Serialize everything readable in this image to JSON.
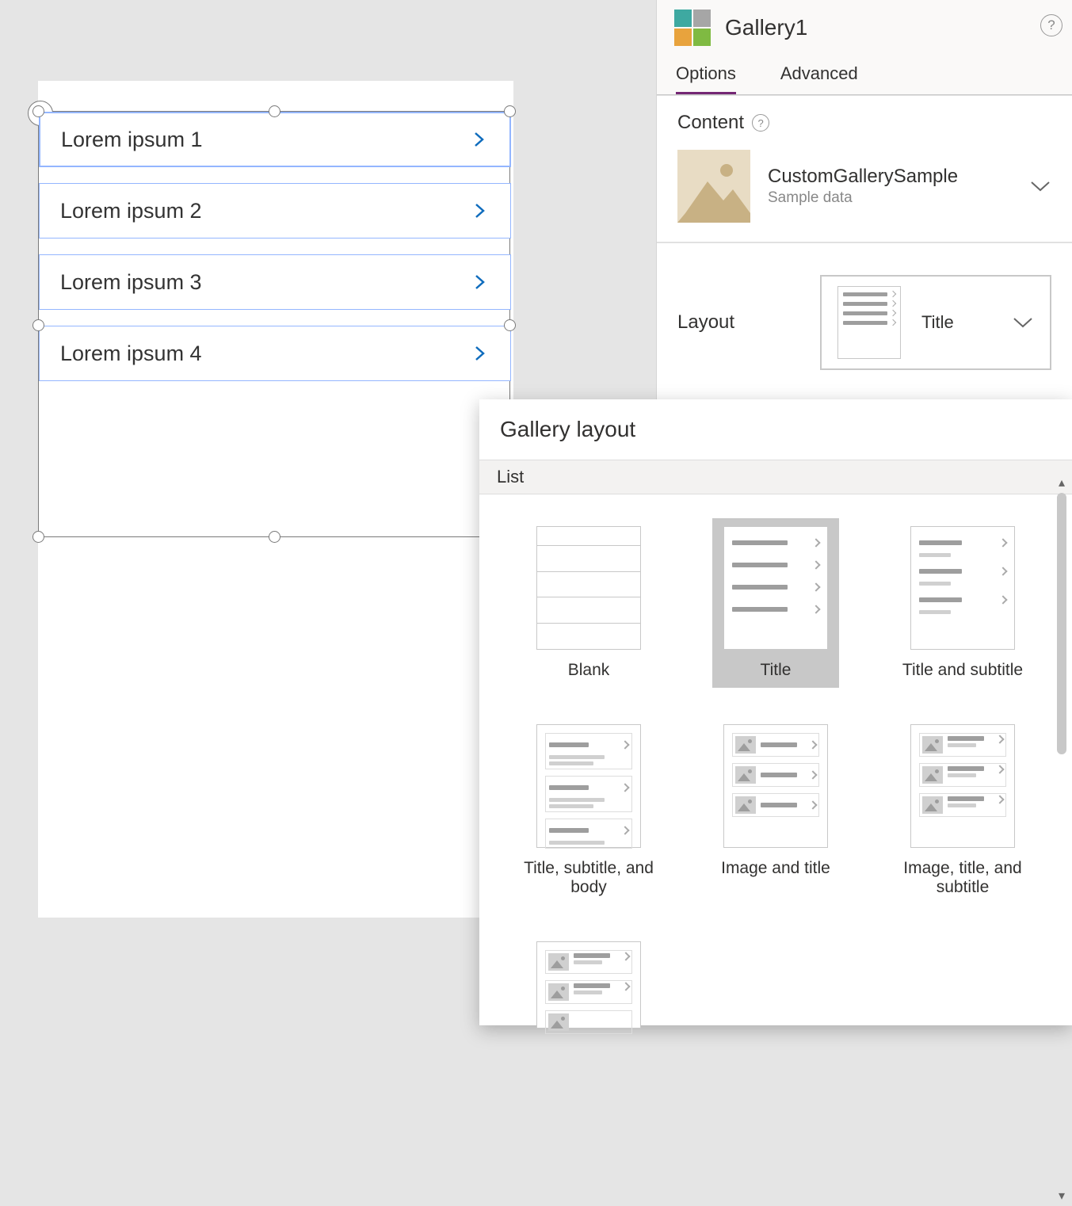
{
  "gallery": {
    "items": [
      {
        "title": "Lorem ipsum 1"
      },
      {
        "title": "Lorem ipsum 2"
      },
      {
        "title": "Lorem ipsum 3"
      },
      {
        "title": "Lorem ipsum 4"
      }
    ]
  },
  "panel": {
    "control_name": "Gallery1",
    "tabs": {
      "options": "Options",
      "advanced": "Advanced",
      "active": "options"
    },
    "content": {
      "label": "Content",
      "datasource_name": "CustomGallerySample",
      "datasource_sub": "Sample data"
    },
    "layout": {
      "label": "Layout",
      "selected": "Title"
    }
  },
  "popup": {
    "title": "Gallery layout",
    "group": "List",
    "selected": "Title",
    "options": [
      "Blank",
      "Title",
      "Title and subtitle",
      "Title, subtitle, and body",
      "Image and title",
      "Image, title, and subtitle"
    ]
  },
  "colors": {
    "teal": "#3ea9a1",
    "grey": "#a6a6a6",
    "orange": "#e8a33d",
    "green": "#7fba42",
    "purple": "#742774"
  }
}
